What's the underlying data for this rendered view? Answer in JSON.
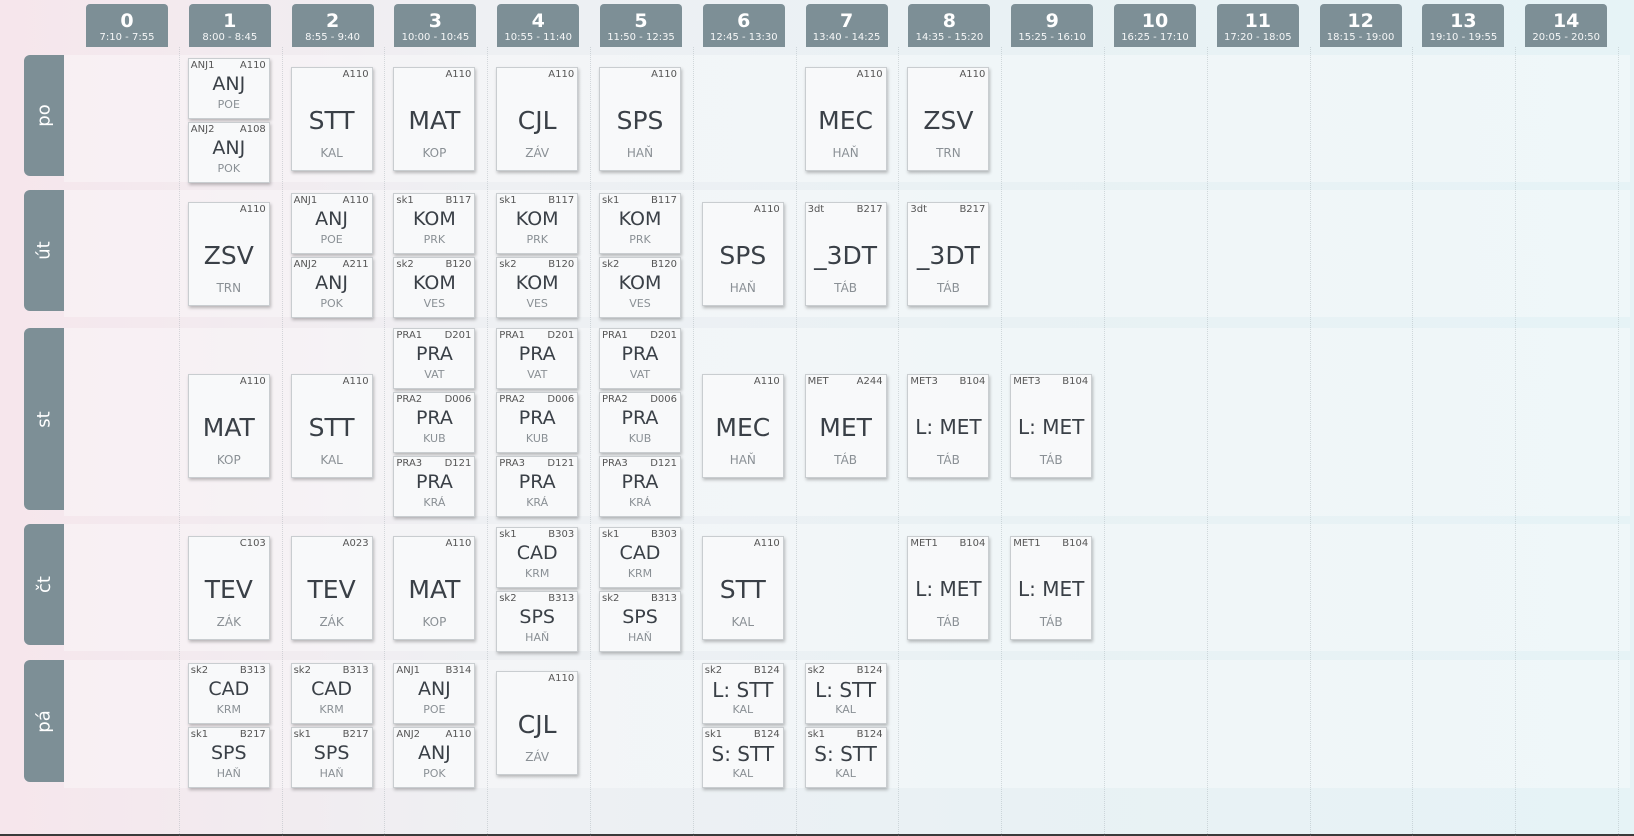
{
  "hours": [
    {
      "num": "0",
      "time": "7:10 - 7:55"
    },
    {
      "num": "1",
      "time": "8:00 - 8:45"
    },
    {
      "num": "2",
      "time": "8:55 - 9:40"
    },
    {
      "num": "3",
      "time": "10:00 - 10:45"
    },
    {
      "num": "4",
      "time": "10:55 - 11:40"
    },
    {
      "num": "5",
      "time": "11:50 - 12:35"
    },
    {
      "num": "6",
      "time": "12:45 - 13:30"
    },
    {
      "num": "7",
      "time": "13:40 - 14:25"
    },
    {
      "num": "8",
      "time": "14:35 - 15:20"
    },
    {
      "num": "9",
      "time": "15:25 - 16:10"
    },
    {
      "num": "10",
      "time": "16:25 - 17:10"
    },
    {
      "num": "11",
      "time": "17:20 - 18:05"
    },
    {
      "num": "12",
      "time": "18:15 - 19:00"
    },
    {
      "num": "13",
      "time": "19:10 - 19:55"
    },
    {
      "num": "14",
      "time": "20:05 - 20:50"
    }
  ],
  "days": [
    {
      "label": "po",
      "slots": [
        {
          "hour": 1,
          "parts": [
            {
              "grp": "ANJ1",
              "room": "A110",
              "subj": "ANJ",
              "teach": "POE"
            },
            {
              "grp": "ANJ2",
              "room": "A108",
              "subj": "ANJ",
              "teach": "POK"
            }
          ]
        },
        {
          "hour": 2,
          "parts": [
            {
              "grp": "",
              "room": "A110",
              "subj": "STT",
              "teach": "KAL"
            }
          ]
        },
        {
          "hour": 3,
          "parts": [
            {
              "grp": "",
              "room": "A110",
              "subj": "MAT",
              "teach": "KOP"
            }
          ]
        },
        {
          "hour": 4,
          "parts": [
            {
              "grp": "",
              "room": "A110",
              "subj": "CJL",
              "teach": "ZÁV"
            }
          ]
        },
        {
          "hour": 5,
          "parts": [
            {
              "grp": "",
              "room": "A110",
              "subj": "SPS",
              "teach": "HAŇ"
            }
          ]
        },
        {
          "hour": 7,
          "parts": [
            {
              "grp": "",
              "room": "A110",
              "subj": "MEC",
              "teach": "HAŇ"
            }
          ]
        },
        {
          "hour": 8,
          "parts": [
            {
              "grp": "",
              "room": "A110",
              "subj": "ZSV",
              "teach": "TRN"
            }
          ]
        }
      ]
    },
    {
      "label": "út",
      "slots": [
        {
          "hour": 1,
          "parts": [
            {
              "grp": "",
              "room": "A110",
              "subj": "ZSV",
              "teach": "TRN"
            }
          ]
        },
        {
          "hour": 2,
          "parts": [
            {
              "grp": "ANJ1",
              "room": "A110",
              "subj": "ANJ",
              "teach": "POE"
            },
            {
              "grp": "ANJ2",
              "room": "A211",
              "subj": "ANJ",
              "teach": "POK"
            }
          ]
        },
        {
          "hour": 3,
          "parts": [
            {
              "grp": "sk1",
              "room": "B117",
              "subj": "KOM",
              "teach": "PRK"
            },
            {
              "grp": "sk2",
              "room": "B120",
              "subj": "KOM",
              "teach": "VES"
            }
          ]
        },
        {
          "hour": 4,
          "parts": [
            {
              "grp": "sk1",
              "room": "B117",
              "subj": "KOM",
              "teach": "PRK"
            },
            {
              "grp": "sk2",
              "room": "B120",
              "subj": "KOM",
              "teach": "VES"
            }
          ]
        },
        {
          "hour": 5,
          "parts": [
            {
              "grp": "sk1",
              "room": "B117",
              "subj": "KOM",
              "teach": "PRK"
            },
            {
              "grp": "sk2",
              "room": "B120",
              "subj": "KOM",
              "teach": "VES"
            }
          ]
        },
        {
          "hour": 6,
          "parts": [
            {
              "grp": "",
              "room": "A110",
              "subj": "SPS",
              "teach": "HAŇ"
            }
          ]
        },
        {
          "hour": 7,
          "parts": [
            {
              "grp": "3dt",
              "room": "B217",
              "subj": "_3DT",
              "teach": "TÁB"
            }
          ]
        },
        {
          "hour": 8,
          "parts": [
            {
              "grp": "3dt",
              "room": "B217",
              "subj": "_3DT",
              "teach": "TÁB"
            }
          ]
        }
      ]
    },
    {
      "label": "st",
      "slots": [
        {
          "hour": 1,
          "parts": [
            {
              "grp": "",
              "room": "A110",
              "subj": "MAT",
              "teach": "KOP"
            }
          ]
        },
        {
          "hour": 2,
          "parts": [
            {
              "grp": "",
              "room": "A110",
              "subj": "STT",
              "teach": "KAL"
            }
          ]
        },
        {
          "hour": 3,
          "parts": [
            {
              "grp": "PRA1",
              "room": "D201",
              "subj": "PRA",
              "teach": "VAT"
            },
            {
              "grp": "PRA2",
              "room": "D006",
              "subj": "PRA",
              "teach": "KUB"
            },
            {
              "grp": "PRA3",
              "room": "D121",
              "subj": "PRA",
              "teach": "KRÁ"
            }
          ]
        },
        {
          "hour": 4,
          "parts": [
            {
              "grp": "PRA1",
              "room": "D201",
              "subj": "PRA",
              "teach": "VAT"
            },
            {
              "grp": "PRA2",
              "room": "D006",
              "subj": "PRA",
              "teach": "KUB"
            },
            {
              "grp": "PRA3",
              "room": "D121",
              "subj": "PRA",
              "teach": "KRÁ"
            }
          ]
        },
        {
          "hour": 5,
          "parts": [
            {
              "grp": "PRA1",
              "room": "D201",
              "subj": "PRA",
              "teach": "VAT"
            },
            {
              "grp": "PRA2",
              "room": "D006",
              "subj": "PRA",
              "teach": "KUB"
            },
            {
              "grp": "PRA3",
              "room": "D121",
              "subj": "PRA",
              "teach": "KRÁ"
            }
          ]
        },
        {
          "hour": 6,
          "parts": [
            {
              "grp": "",
              "room": "A110",
              "subj": "MEC",
              "teach": "HAŇ"
            }
          ]
        },
        {
          "hour": 7,
          "parts": [
            {
              "grp": "MET",
              "room": "A244",
              "subj": "MET",
              "teach": "TÁB"
            }
          ]
        },
        {
          "hour": 8,
          "parts": [
            {
              "grp": "MET3",
              "room": "B104",
              "subj": "L: MET",
              "teach": "TÁB"
            }
          ]
        },
        {
          "hour": 9,
          "parts": [
            {
              "grp": "MET3",
              "room": "B104",
              "subj": "L: MET",
              "teach": "TÁB"
            }
          ]
        }
      ]
    },
    {
      "label": "čt",
      "slots": [
        {
          "hour": 1,
          "parts": [
            {
              "grp": "",
              "room": "C103",
              "subj": "TEV",
              "teach": "ZÁK"
            }
          ]
        },
        {
          "hour": 2,
          "parts": [
            {
              "grp": "",
              "room": "A023",
              "subj": "TEV",
              "teach": "ZÁK"
            }
          ]
        },
        {
          "hour": 3,
          "parts": [
            {
              "grp": "",
              "room": "A110",
              "subj": "MAT",
              "teach": "KOP"
            }
          ]
        },
        {
          "hour": 4,
          "parts": [
            {
              "grp": "sk1",
              "room": "B303",
              "subj": "CAD",
              "teach": "KRM"
            },
            {
              "grp": "sk2",
              "room": "B313",
              "subj": "SPS",
              "teach": "HAŇ"
            }
          ]
        },
        {
          "hour": 5,
          "parts": [
            {
              "grp": "sk1",
              "room": "B303",
              "subj": "CAD",
              "teach": "KRM"
            },
            {
              "grp": "sk2",
              "room": "B313",
              "subj": "SPS",
              "teach": "HAŇ"
            }
          ]
        },
        {
          "hour": 6,
          "parts": [
            {
              "grp": "",
              "room": "A110",
              "subj": "STT",
              "teach": "KAL"
            }
          ]
        },
        {
          "hour": 8,
          "parts": [
            {
              "grp": "MET1",
              "room": "B104",
              "subj": "L: MET",
              "teach": "TÁB"
            }
          ]
        },
        {
          "hour": 9,
          "parts": [
            {
              "grp": "MET1",
              "room": "B104",
              "subj": "L: MET",
              "teach": "TÁB"
            }
          ]
        }
      ]
    },
    {
      "label": "pá",
      "slots": [
        {
          "hour": 1,
          "parts": [
            {
              "grp": "sk2",
              "room": "B313",
              "subj": "CAD",
              "teach": "KRM"
            },
            {
              "grp": "sk1",
              "room": "B217",
              "subj": "SPS",
              "teach": "HAŇ"
            }
          ]
        },
        {
          "hour": 2,
          "parts": [
            {
              "grp": "sk2",
              "room": "B313",
              "subj": "CAD",
              "teach": "KRM"
            },
            {
              "grp": "sk1",
              "room": "B217",
              "subj": "SPS",
              "teach": "HAŇ"
            }
          ]
        },
        {
          "hour": 3,
          "parts": [
            {
              "grp": "ANJ1",
              "room": "B314",
              "subj": "ANJ",
              "teach": "POE"
            },
            {
              "grp": "ANJ2",
              "room": "A110",
              "subj": "ANJ",
              "teach": "POK"
            }
          ]
        },
        {
          "hour": 4,
          "parts": [
            {
              "grp": "",
              "room": "A110",
              "subj": "CJL",
              "teach": "ZÁV"
            }
          ]
        },
        {
          "hour": 6,
          "parts": [
            {
              "grp": "sk2",
              "room": "B124",
              "subj": "L: STT",
              "teach": "KAL"
            },
            {
              "grp": "sk1",
              "room": "B124",
              "subj": "S: STT",
              "teach": "KAL"
            }
          ]
        },
        {
          "hour": 7,
          "parts": [
            {
              "grp": "sk2",
              "room": "B124",
              "subj": "L: STT",
              "teach": "KAL"
            },
            {
              "grp": "sk1",
              "room": "B124",
              "subj": "S: STT",
              "teach": "KAL"
            }
          ]
        }
      ]
    }
  ]
}
